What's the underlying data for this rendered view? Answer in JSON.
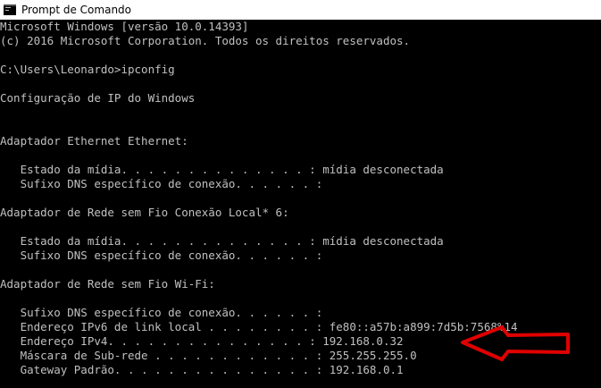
{
  "window": {
    "title": "Prompt de Comando"
  },
  "console": {
    "header_1": "Microsoft Windows [versão 10.0.14393]",
    "header_2": "(c) 2016 Microsoft Corporation. Todos os direitos reservados.",
    "prompt": "C:\\Users\\Leonardo>ipconfig",
    "config_title": "Configuração de IP do Windows",
    "adapter_ethernet": {
      "title": "Adaptador Ethernet Ethernet:",
      "media_state": "   Estado da mídia. . . . . . . . . . . . . . : mídia desconectada",
      "dns_suffix": "   Sufixo DNS específico de conexão. . . . . . :"
    },
    "adapter_local": {
      "title": "Adaptador de Rede sem Fio Conexão Local* 6:",
      "media_state": "   Estado da mídia. . . . . . . . . . . . . . : mídia desconectada",
      "dns_suffix": "   Sufixo DNS específico de conexão. . . . . . :"
    },
    "adapter_wifi": {
      "title": "Adaptador de Rede sem Fio Wi-Fi:",
      "dns_suffix": "   Sufixo DNS específico de conexão. . . . . . :",
      "ipv6": "   Endereço IPv6 de link local . . . . . . . . : fe80::a57b:a899:7d5b:7568%14",
      "ipv4": "   Endereço IPv4. . . . . . . . . . . . . . . : 192.168.0.32",
      "subnet": "   Máscara de Sub-rede . . . . . . . . . . . . : 255.255.255.0",
      "gateway": "   Gateway Padrão. . . . . . . . . . . . . . . : 192.168.0.1"
    }
  },
  "colors": {
    "console_background": "#000000",
    "console_text": "#c0c0c0",
    "annotation_arrow": "#e00000"
  },
  "icons": {
    "title_icon": "command-prompt-icon",
    "annotation": "red-arrow-annotation-icon"
  }
}
